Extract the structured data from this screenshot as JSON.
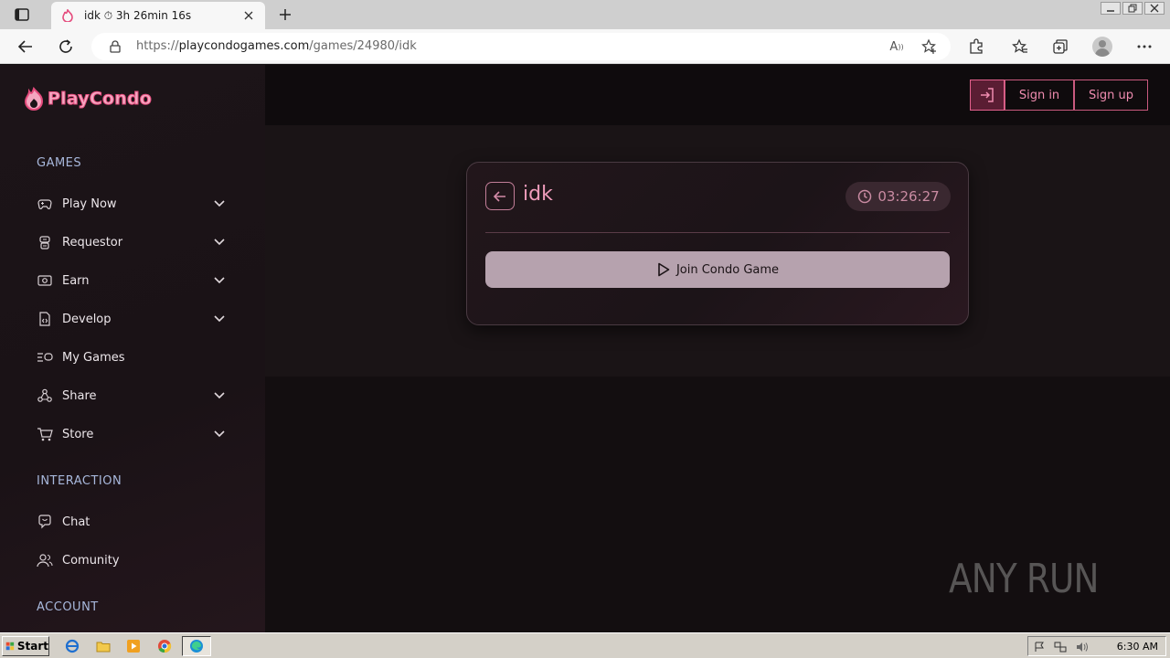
{
  "browser": {
    "tab": {
      "title": "idk ⏱ 3h 26min 16s"
    },
    "url": {
      "prefix": "https://",
      "host": "playcondogames.com",
      "path": "/games/24980/idk"
    },
    "read_aloud_glyph": "A͉"
  },
  "site": {
    "logo_text": "PlayCondo",
    "brand_color": "#e54c7d",
    "accent_color": "#f08cb0"
  },
  "sidebar": {
    "sections": {
      "games": "GAMES",
      "interaction": "INTERACTION",
      "account": "ACCOUNT"
    },
    "items": [
      {
        "label": "Play Now",
        "icon": "gamepad-icon",
        "has_chevron": true
      },
      {
        "label": "Requestor",
        "icon": "robot-icon",
        "has_chevron": true
      },
      {
        "label": "Earn",
        "icon": "money-icon",
        "has_chevron": true
      },
      {
        "label": "Develop",
        "icon": "code-file-icon",
        "has_chevron": true
      },
      {
        "label": "My Games",
        "icon": "game-list-icon",
        "has_chevron": false
      },
      {
        "label": "Share",
        "icon": "share-icon",
        "has_chevron": true
      },
      {
        "label": "Store",
        "icon": "cart-icon",
        "has_chevron": true
      },
      {
        "label": "Chat",
        "icon": "chat-icon",
        "has_chevron": false
      },
      {
        "label": "Comunity",
        "icon": "users-icon",
        "has_chevron": false
      }
    ]
  },
  "header": {
    "sign_in": "Sign in",
    "sign_up": "Sign up"
  },
  "game": {
    "title": "idk",
    "timer": "03:26:27",
    "join_label": "Join Condo Game"
  },
  "watermark": "ANY RUN",
  "taskbar": {
    "start_label": "Start",
    "clock": "6:30 AM"
  }
}
